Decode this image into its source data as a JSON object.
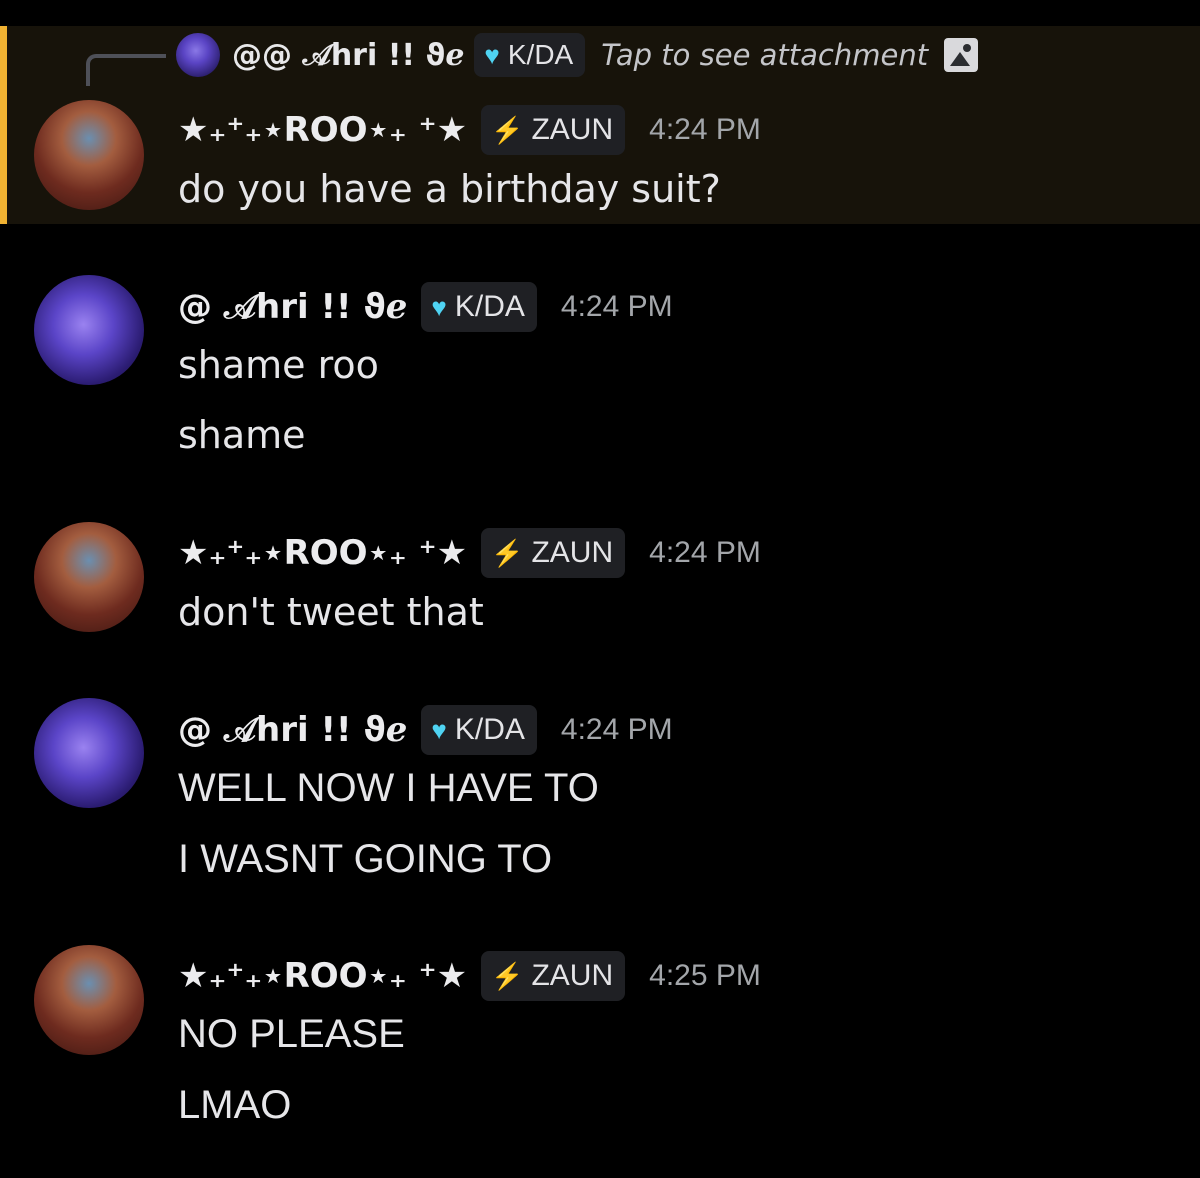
{
  "colors": {
    "background": "#000000",
    "highlight_band": "#17130a",
    "highlight_bar": "#f0b232",
    "tag_background": "#1f2024",
    "timestamp": "#a3a6aa",
    "kda_heart": "#4fd3f2",
    "zaun_bolt": "#33e14a"
  },
  "reply": {
    "username": "@@ 𝒜hri !! ϑℯ",
    "tag_icon": "heart-icon",
    "tag_label": "K/DA",
    "text": "Tap to see attachment",
    "attachment_icon": "image-icon"
  },
  "messages": [
    {
      "username": "★₊⁺₊⋆ROO⋆₊ ⁺★",
      "tag_icon": "bolt-icon",
      "tag_label": "ZAUN",
      "timestamp": "4:24 PM",
      "lines": [
        "do you have a birthday suit?"
      ]
    },
    {
      "username": "@ 𝒜hri !! ϑℯ",
      "tag_icon": "heart-icon",
      "tag_label": "K/DA",
      "timestamp": "4:24 PM",
      "lines": [
        "shame roo",
        "shame"
      ]
    },
    {
      "username": "★₊⁺₊⋆ROO⋆₊ ⁺★",
      "tag_icon": "bolt-icon",
      "tag_label": "ZAUN",
      "timestamp": "4:24 PM",
      "lines": [
        "don't tweet that"
      ]
    },
    {
      "username": "@ 𝒜hri !! ϑℯ",
      "tag_icon": "heart-icon",
      "tag_label": "K/DA",
      "timestamp": "4:24 PM",
      "lines": [
        "WELL NOW I HAVE TO",
        "I WASNT GOING TO"
      ]
    },
    {
      "username": "★₊⁺₊⋆ROO⋆₊ ⁺★",
      "tag_icon": "bolt-icon",
      "tag_label": "ZAUN",
      "timestamp": "4:25 PM",
      "lines": [
        "NO PLEASE",
        "LMAO"
      ]
    }
  ]
}
